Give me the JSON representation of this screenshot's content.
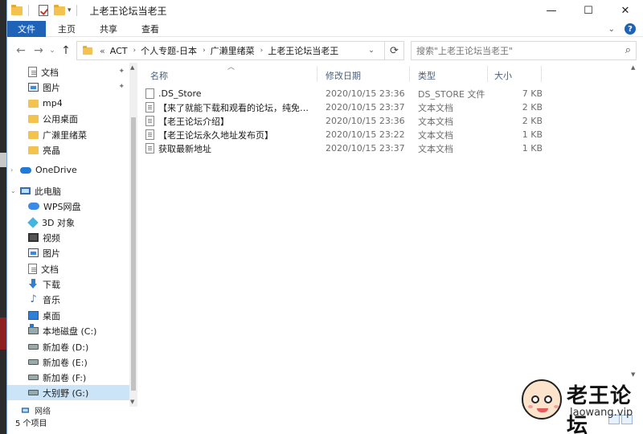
{
  "titlebar": {
    "title": "上老王论坛当老王",
    "minimize": "—",
    "maximize": "☐",
    "close": "✕"
  },
  "ribbon": {
    "tabs": [
      "文件",
      "主页",
      "共享",
      "查看"
    ]
  },
  "address": {
    "crumbs": [
      "ACT",
      "个人专题-日本",
      "广濑里绪菜",
      "上老王论坛当老王"
    ],
    "overflow": "«",
    "search_placeholder": "搜索\"上老王论坛当老王\""
  },
  "sidebar": {
    "items": [
      {
        "label": "文档",
        "icon": "document-icon",
        "pinned": true
      },
      {
        "label": "图片",
        "icon": "picture-icon",
        "pinned": true
      },
      {
        "label": "mp4",
        "icon": "folder-icon",
        "pinned": false
      },
      {
        "label": "公用桌面",
        "icon": "folder-icon",
        "pinned": false
      },
      {
        "label": "广濑里绪菜",
        "icon": "folder-icon",
        "pinned": false
      },
      {
        "label": "亮晶",
        "icon": "folder-icon",
        "pinned": false
      },
      {
        "label": "OneDrive",
        "icon": "onedrive-icon"
      },
      {
        "label": "此电脑",
        "icon": "this-pc-icon"
      },
      {
        "label": "WPS网盘",
        "icon": "wps-cloud-icon"
      },
      {
        "label": "3D 对象",
        "icon": "3d-objects-icon"
      },
      {
        "label": "视频",
        "icon": "video-icon"
      },
      {
        "label": "图片",
        "icon": "picture-icon"
      },
      {
        "label": "文档",
        "icon": "document-icon"
      },
      {
        "label": "下载",
        "icon": "download-icon"
      },
      {
        "label": "音乐",
        "icon": "music-icon"
      },
      {
        "label": "桌面",
        "icon": "desktop-icon"
      },
      {
        "label": "本地磁盘 (C:)",
        "icon": "local-disk-icon"
      },
      {
        "label": "新加卷 (D:)",
        "icon": "drive-icon"
      },
      {
        "label": "新加卷 (E:)",
        "icon": "drive-icon"
      },
      {
        "label": "新加卷 (F:)",
        "icon": "drive-icon"
      },
      {
        "label": "大别野 (G:)",
        "icon": "drive-icon",
        "selected": true
      },
      {
        "label": "网络",
        "icon": "network-icon"
      }
    ]
  },
  "columns": {
    "name": "名称",
    "date": "修改日期",
    "type": "类型",
    "size": "大小"
  },
  "files": [
    {
      "name": ".DS_Store",
      "date": "2020/10/15 23:36",
      "type": "DS_STORE 文件",
      "size": "7 KB",
      "icon": "file-icon"
    },
    {
      "name": "【来了就能下载和观看的论坛，纯免费！...",
      "date": "2020/10/15 23:37",
      "type": "文本文档",
      "size": "2 KB",
      "icon": "text-file-icon"
    },
    {
      "name": "【老王论坛介绍】",
      "date": "2020/10/15 23:36",
      "type": "文本文档",
      "size": "2 KB",
      "icon": "text-file-icon"
    },
    {
      "name": "【老王论坛永久地址发布页】",
      "date": "2020/10/15 23:22",
      "type": "文本文档",
      "size": "1 KB",
      "icon": "text-file-icon"
    },
    {
      "name": "获取最新地址",
      "date": "2020/10/15 23:37",
      "type": "文本文档",
      "size": "1 KB",
      "icon": "text-file-icon"
    }
  ],
  "status": {
    "count": "5 个项目"
  },
  "watermark": {
    "title": "老王论坛",
    "url": "laowang.vip"
  }
}
